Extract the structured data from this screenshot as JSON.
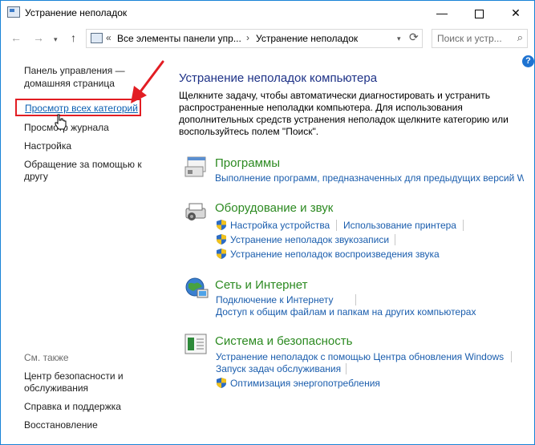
{
  "window": {
    "title": "Устранение неполадок",
    "minimize": "—",
    "close": "✕"
  },
  "nav": {
    "back": "←",
    "forward": "→",
    "up": "↑",
    "address_prefix": "«",
    "address_part1": "Все элементы панели упр...",
    "address_sep": "›",
    "address_part2": "Устранение неполадок",
    "search_placeholder": "Поиск и устр..."
  },
  "help": "?",
  "sidebar": {
    "home_line1": "Панель управления —",
    "home_line2": "домашняя страница",
    "all_categories": "Просмотр всех категорий",
    "history": "Просмотр журнала",
    "settings": "Настройка",
    "ask_help_line1": "Обращение за помощью к",
    "ask_help_line2": "другу",
    "see_also": "См. также",
    "security_center_line1": "Центр безопасности и",
    "security_center_line2": "обслуживания",
    "support": "Справка и поддержка",
    "recovery": "Восстановление"
  },
  "main": {
    "heading": "Устранение неполадок компьютера",
    "description": "Щелкните задачу, чтобы автоматически диагностировать и устранить распространенные неполадки компьютера. Для использования дополнительных средств устранения неполадок щелкните категорию или воспользуйтесь полем \"Поиск\"."
  },
  "categories": {
    "programs": {
      "title": "Программы",
      "link1": "Выполнение программ, предназначенных для предыдущих версий Windows"
    },
    "hardware": {
      "title": "Оборудование и звук",
      "link1": "Настройка устройства",
      "link2": "Использование принтера",
      "link3": "Устранение неполадок звукозаписи",
      "link4": "Устранение неполадок воспроизведения звука"
    },
    "network": {
      "title": "Сеть и Интернет",
      "link1": "Подключение к Интернету",
      "link2": "Доступ к общим файлам и папкам на других компьютерах"
    },
    "system": {
      "title": "Система и безопасность",
      "link1": "Устранение неполадок с помощью Центра обновления Windows",
      "link2": "Запуск задач обслуживания",
      "link3": "Оптимизация энергопотребления"
    }
  },
  "colors": {
    "accent_border": "#1883d7",
    "heading": "#1e3287",
    "category_title": "#2c8a21",
    "link": "#1a5dad",
    "highlight": "#e21d23"
  }
}
